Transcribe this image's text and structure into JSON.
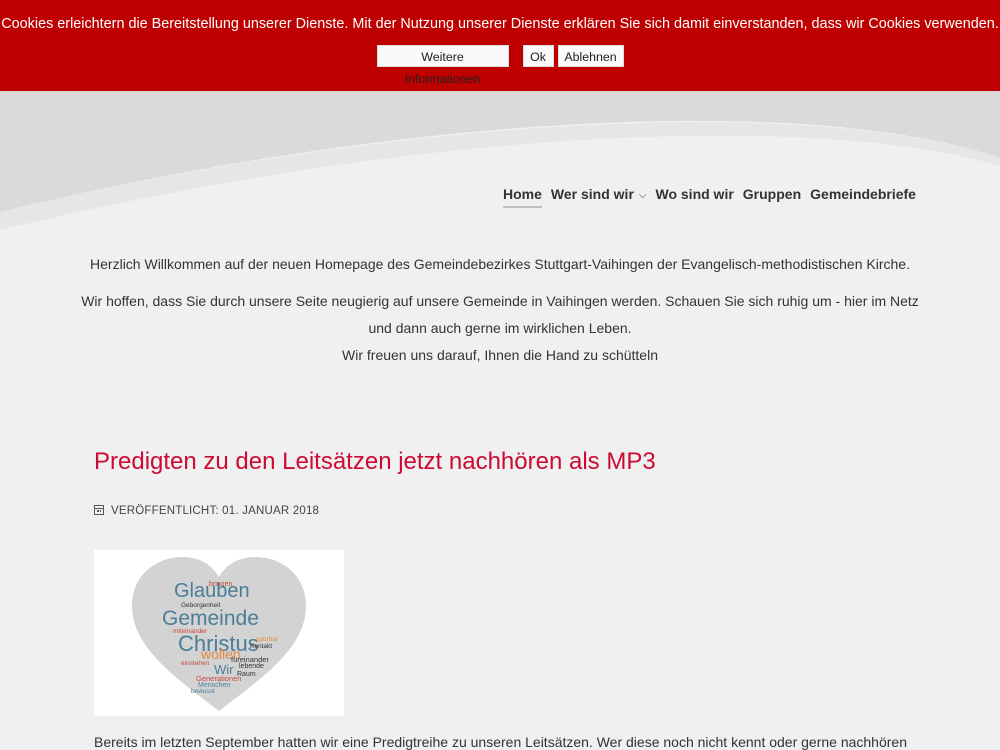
{
  "cookie": {
    "message": "Cookies erleichtern die Bereitstellung unserer Dienste. Mit der Nutzung unserer Dienste erklären Sie sich damit einverstanden, dass wir Cookies verwenden.",
    "more_label": "Weitere Informationen",
    "ok_label": "Ok",
    "deny_label": "Ablehnen",
    "bar_color": "#bf0000"
  },
  "nav": {
    "items": [
      {
        "label": "Home",
        "active": true
      },
      {
        "label": "Wer sind wir",
        "has_dropdown": true,
        "icon": "chevron-down-icon"
      },
      {
        "label": "Wo sind wir"
      },
      {
        "label": "Gruppen"
      },
      {
        "label": "Gemeindebriefe"
      }
    ]
  },
  "intro": {
    "line1": "Herzlich Willkommen auf der neuen Homepage des Gemeindebezirkes Stuttgart-Vaihingen der Evangelisch-methodistischen Kirche.",
    "line2": "Wir hoffen, dass Sie durch unsere Seite neugierig auf unsere Gemeinde in Vaihingen werden. Schauen Sie sich ruhig um - hier im Netz",
    "line3": "und dann auch gerne im wirklichen Leben.",
    "line4": "Wir freuen uns darauf, Ihnen die Hand zu schütteln"
  },
  "article": {
    "title": "Predigten zu den Leitsätzen jetzt nachhören als MP3",
    "title_color": "#cc0a32",
    "meta_icon": "calendar-icon",
    "published": "VERÖFFENTLICHT: 01. JANUAR 2018",
    "image": {
      "shape": "heart-word-cloud",
      "words": [
        "bringen",
        "Glauben",
        "Geborgenheit",
        "Gemeinde",
        "miteinander",
        "Christus",
        "spürbar",
        "Kontakt",
        "wollen",
        "füreinander",
        "lebende",
        "einstehen",
        "Wir",
        "Raum",
        "Generationen",
        "Menschen",
        "bewusst"
      ]
    },
    "body": "Bereits im letzten September hatten wir eine Predigtreihe zu unseren Leitsätzen. Wer diese noch nicht kennt oder gerne nachhören"
  }
}
